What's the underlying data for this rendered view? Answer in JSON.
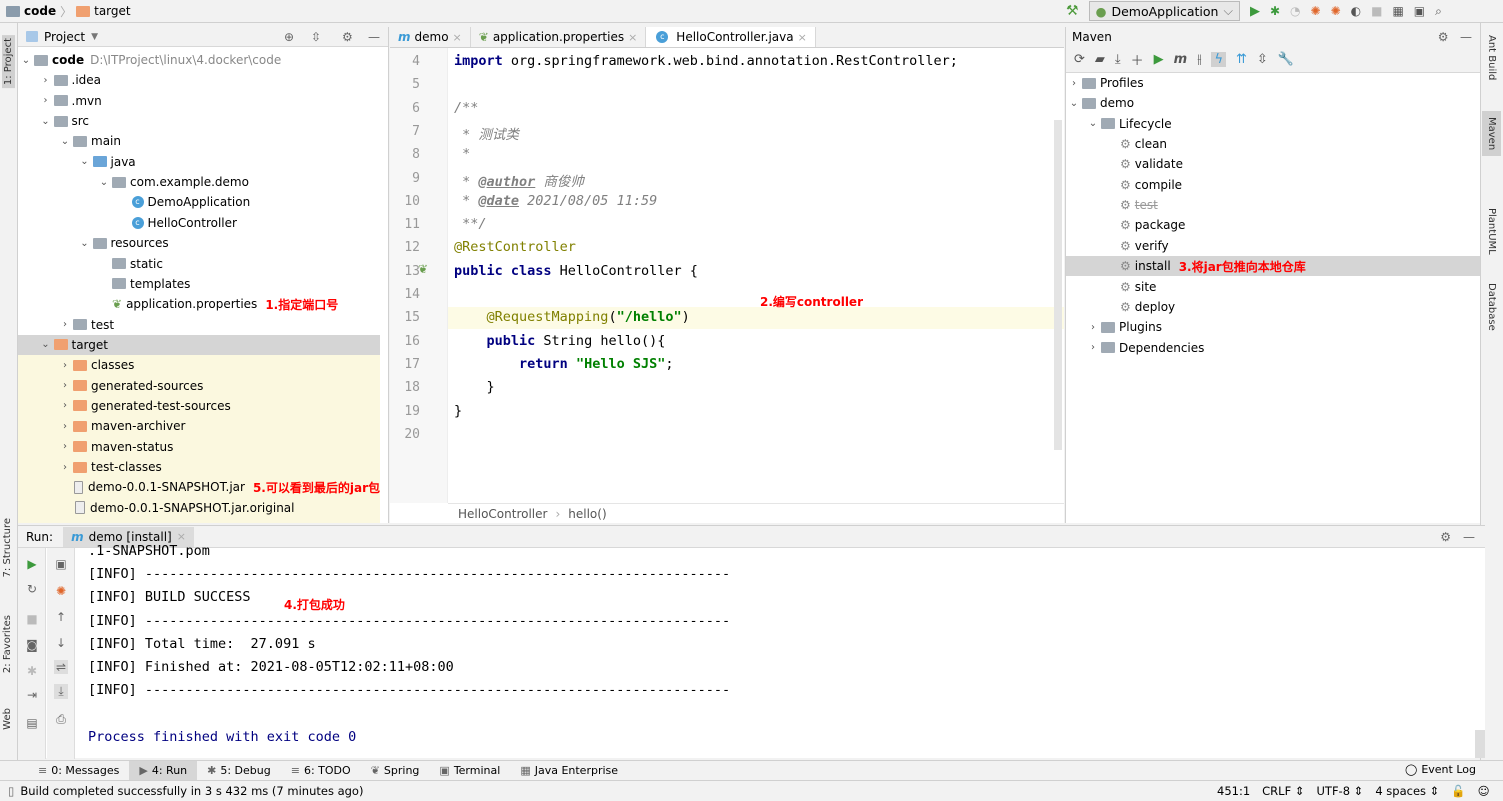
{
  "breadcrumb": [
    "code",
    "target"
  ],
  "run_config": "DemoApplication",
  "project": {
    "title": "Project",
    "tree": [
      {
        "label": "code",
        "extra": "D:\\ITProject\\linux\\4.docker\\code",
        "depth": 0,
        "chev": "v",
        "icon": "folder",
        "bold": true
      },
      {
        "label": ".idea",
        "depth": 1,
        "chev": ">",
        "icon": "folder"
      },
      {
        "label": ".mvn",
        "depth": 1,
        "chev": ">",
        "icon": "folder"
      },
      {
        "label": "src",
        "depth": 1,
        "chev": "v",
        "icon": "folder"
      },
      {
        "label": "main",
        "depth": 2,
        "chev": "v",
        "icon": "folder"
      },
      {
        "label": "java",
        "depth": 3,
        "chev": "v",
        "icon": "src-folder"
      },
      {
        "label": "com.example.demo",
        "depth": 4,
        "chev": "v",
        "icon": "package"
      },
      {
        "label": "DemoApplication",
        "depth": 5,
        "icon": "class"
      },
      {
        "label": "HelloController",
        "depth": 5,
        "icon": "class"
      },
      {
        "label": "resources",
        "depth": 3,
        "chev": "v",
        "icon": "res-folder"
      },
      {
        "label": "static",
        "depth": 4,
        "icon": "folder"
      },
      {
        "label": "templates",
        "depth": 4,
        "icon": "folder"
      },
      {
        "label": "application.properties",
        "depth": 4,
        "icon": "spring",
        "note": "1.指定端口号"
      },
      {
        "label": "test",
        "depth": 2,
        "chev": ">",
        "icon": "folder"
      },
      {
        "label": "target",
        "depth": 1,
        "chev": "v",
        "icon": "excluded-folder",
        "selected": true
      },
      {
        "label": "classes",
        "depth": 2,
        "chev": ">",
        "icon": "excluded-folder"
      },
      {
        "label": "generated-sources",
        "depth": 2,
        "chev": ">",
        "icon": "excluded-folder"
      },
      {
        "label": "generated-test-sources",
        "depth": 2,
        "chev": ">",
        "icon": "excluded-folder"
      },
      {
        "label": "maven-archiver",
        "depth": 2,
        "chev": ">",
        "icon": "excluded-folder"
      },
      {
        "label": "maven-status",
        "depth": 2,
        "chev": ">",
        "icon": "excluded-folder"
      },
      {
        "label": "test-classes",
        "depth": 2,
        "chev": ">",
        "icon": "excluded-folder"
      },
      {
        "label": "demo-0.0.1-SNAPSHOT.jar",
        "depth": 2,
        "icon": "jar",
        "note": "5.可以看到最后的jar包"
      },
      {
        "label": "demo-0.0.1-SNAPSHOT.jar.original",
        "depth": 2,
        "icon": "file"
      }
    ]
  },
  "editor": {
    "tabs": [
      {
        "label": "demo",
        "icon": "maven"
      },
      {
        "label": "application.properties",
        "icon": "spring"
      },
      {
        "label": "HelloController.java",
        "icon": "class",
        "active": true
      }
    ],
    "lines": [
      {
        "n": "4",
        "html": "<span class='kw'>import</span> org.springframework.web.bind.annotation.RestController;"
      },
      {
        "n": "5",
        "html": ""
      },
      {
        "n": "6",
        "html": "<span class='cm'>/**</span>"
      },
      {
        "n": "7",
        "html": "<span class='cm'> * 测试类</span>"
      },
      {
        "n": "8",
        "html": "<span class='cm'> *</span>"
      },
      {
        "n": "9",
        "html": "<span class='cm'> * <b><u>@author</u></b> 商俊帅</span>"
      },
      {
        "n": "10",
        "html": "<span class='cm'> * <b><u>@date</u></b> 2021/08/05 11:59</span>"
      },
      {
        "n": "11",
        "html": "<span class='cm'> **/</span>"
      },
      {
        "n": "12",
        "html": "<span class='an'>@RestController</span>"
      },
      {
        "n": "13",
        "html": "<span class='kw'>public class</span> HelloController {"
      },
      {
        "n": "14",
        "html": ""
      },
      {
        "n": "15",
        "html": "    <span class='an'>@RequestMapping</span>(<span class='st'>\"/hello\"</span>)"
      },
      {
        "n": "16",
        "html": "    <span class='kw'>public</span> String hello(){"
      },
      {
        "n": "17",
        "html": "        <span class='kw'>return</span> <span class='st'>\"Hello SJS\"</span>;"
      },
      {
        "n": "18",
        "html": "    }"
      },
      {
        "n": "19",
        "html": "}"
      },
      {
        "n": "20",
        "html": ""
      }
    ],
    "note": "2.编写controller",
    "breadcrumb": [
      "HelloController",
      "hello()"
    ]
  },
  "maven": {
    "title": "Maven",
    "tree": [
      {
        "label": "Profiles",
        "depth": 0,
        "chev": ">",
        "icon": "profiles"
      },
      {
        "label": "demo",
        "depth": 0,
        "chev": "v",
        "icon": "maven"
      },
      {
        "label": "Lifecycle",
        "depth": 1,
        "chev": "v",
        "icon": "folder"
      },
      {
        "label": "clean",
        "depth": 2,
        "icon": "gear"
      },
      {
        "label": "validate",
        "depth": 2,
        "icon": "gear"
      },
      {
        "label": "compile",
        "depth": 2,
        "icon": "gear"
      },
      {
        "label": "test",
        "depth": 2,
        "icon": "gear",
        "strike": true
      },
      {
        "label": "package",
        "depth": 2,
        "icon": "gear"
      },
      {
        "label": "verify",
        "depth": 2,
        "icon": "gear"
      },
      {
        "label": "install",
        "depth": 2,
        "icon": "gear",
        "selected": true,
        "note": "3.将jar包推向本地仓库"
      },
      {
        "label": "site",
        "depth": 2,
        "icon": "gear"
      },
      {
        "label": "deploy",
        "depth": 2,
        "icon": "gear"
      },
      {
        "label": "Plugins",
        "depth": 1,
        "chev": ">",
        "icon": "folder"
      },
      {
        "label": "Dependencies",
        "depth": 1,
        "chev": ">",
        "icon": "folder"
      }
    ]
  },
  "right_tabs": [
    "Ant Build",
    "Maven",
    "PlantUML",
    "Database"
  ],
  "left_tabs": [
    "1: Project",
    "7: Structure",
    "2: Favorites",
    "Web"
  ],
  "run": {
    "label": "Run:",
    "tab": "demo [install]",
    "lines": [
      ".1-SNAPSHOT.pom",
      "[INFO] ------------------------------------------------------------------------",
      "[INFO] BUILD SUCCESS",
      "[INFO] ------------------------------------------------------------------------",
      "[INFO] Total time:  27.091 s",
      "[INFO] Finished at: 2021-08-05T12:02:11+08:00",
      "[INFO] ------------------------------------------------------------------------",
      "",
      "Process finished with exit code 0"
    ],
    "note": "4.打包成功"
  },
  "bottom_tabs": [
    "0: Messages",
    "4: Run",
    "5: Debug",
    "6: TODO",
    "Spring",
    "Terminal",
    "Java Enterprise"
  ],
  "event_log": "Event Log",
  "status": {
    "message": "Build completed successfully in 3 s 432 ms (7 minutes ago)",
    "position": "451:1",
    "line_sep": "CRLF",
    "encoding": "UTF-8",
    "indent": "4 spaces"
  }
}
